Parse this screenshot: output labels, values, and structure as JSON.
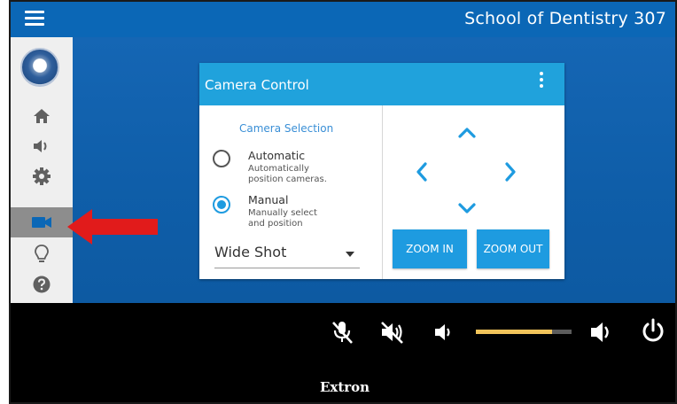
{
  "header": {
    "room_name": "School of Dentistry 307"
  },
  "sidebar": {
    "items": [
      {
        "icon": "home-icon"
      },
      {
        "icon": "speaker-icon"
      },
      {
        "icon": "gear-icon"
      },
      {
        "icon": "video-camera-icon",
        "active": true
      },
      {
        "icon": "lightbulb-icon"
      },
      {
        "icon": "help-icon"
      }
    ]
  },
  "camera_card": {
    "title": "Camera Control",
    "selection_label": "Camera Selection",
    "options": [
      {
        "name": "Automatic",
        "description": "Automatically position cameras.",
        "selected": false
      },
      {
        "name": "Manual",
        "description": "Manually select and position",
        "selected": true
      }
    ],
    "preset_value": "Wide Shot",
    "zoom_in_label": "ZOOM IN",
    "zoom_out_label": "ZOOM OUT"
  },
  "controls": {
    "volume_level": 0.8,
    "volume_color": "#f2c45a"
  },
  "footer": {
    "brand": "Extron"
  },
  "colors": {
    "topbar": "#0b67b6",
    "card_header": "#20a2dc",
    "accent": "#1e9be0",
    "annotation_arrow": "#e11b1b"
  }
}
